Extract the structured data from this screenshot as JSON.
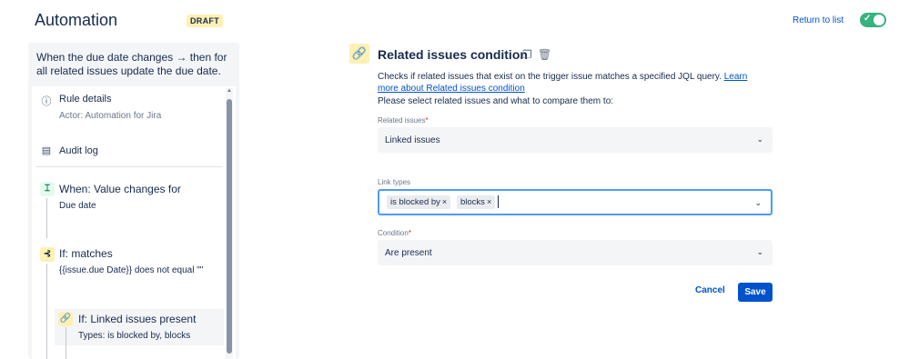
{
  "header": {
    "title": "Automation",
    "badge": "DRAFT",
    "return_label": "Return to list",
    "toggle_state": "enabled"
  },
  "sidebar": {
    "rule_description": "When the due date changes → then for all related issues update the due date.",
    "items": [
      {
        "title": "Rule details",
        "subtitle": "Actor: Automation for Jira",
        "icon": "info-icon"
      },
      {
        "title": "Audit log",
        "icon": "document-icon"
      },
      {
        "title": "When: Value changes for",
        "subtitle": "Due date",
        "icon": "trigger-icon"
      },
      {
        "title": "If: matches",
        "subtitle": "{{issue.due Date}} does not equal \"\"",
        "icon": "condition-branch-icon"
      },
      {
        "title": "If: Linked issues present",
        "subtitle": "Types: is blocked by, blocks",
        "icon": "link-icon"
      }
    ]
  },
  "panel": {
    "title": "Related issues condition",
    "description": "Checks if related issues that exist on the trigger issue matches a specified JQL query.",
    "learn_more": "Learn more about Related issues condition",
    "instruction": "Please select related issues and what to compare them to:",
    "related_issues": {
      "label": "Related issues",
      "value": "Linked issues"
    },
    "link_types": {
      "label": "Link types",
      "chips": [
        "is blocked by",
        "blocks"
      ]
    },
    "condition": {
      "label": "Condition",
      "value": "Are present"
    },
    "cancel_label": "Cancel",
    "save_label": "Save"
  },
  "colors": {
    "accent": "#0052cc",
    "toggle_on": "#36b37e",
    "draft_badge": "#fff0b3",
    "focus_border": "#4c9aff"
  }
}
